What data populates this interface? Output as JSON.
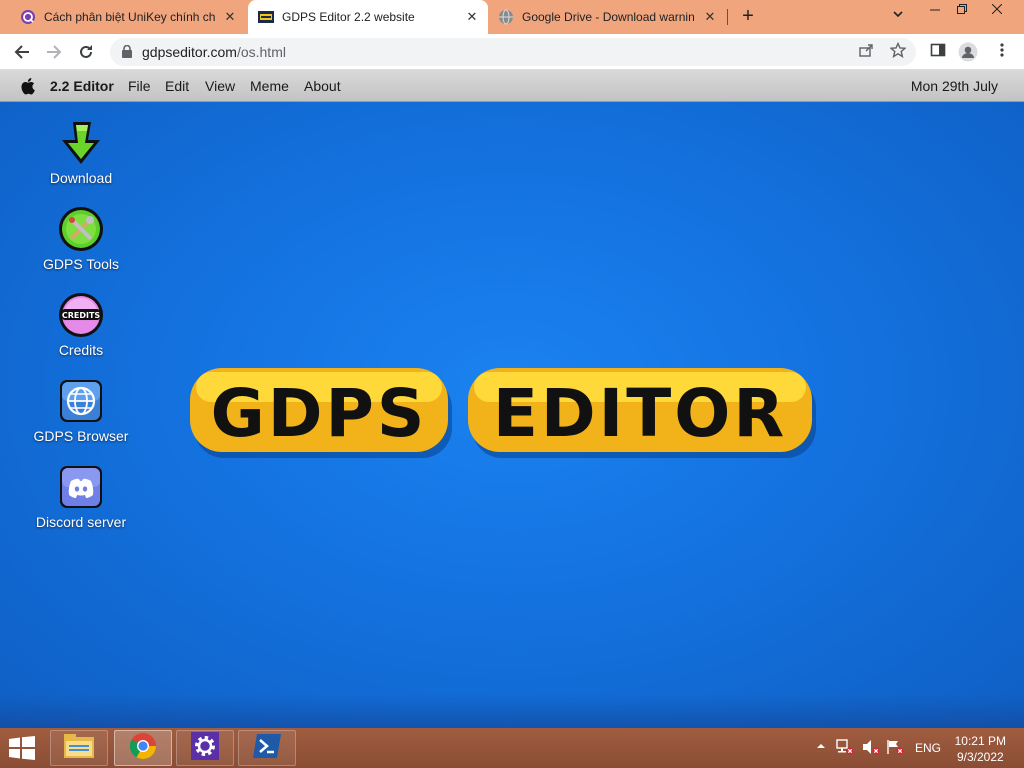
{
  "browser": {
    "tabs": [
      {
        "title": "Cách phân biệt UniKey chính chủ",
        "favicon": "unikey-icon",
        "active": false
      },
      {
        "title": "GDPS Editor 2.2 website",
        "favicon": "gdps-site-icon",
        "active": true
      },
      {
        "title": "Google Drive - Download warning",
        "favicon": "globe-icon",
        "active": false
      }
    ],
    "close_glyph": "✕",
    "new_tab_glyph": "+",
    "url_host": "gdpseditor.com",
    "url_path": "/os.html"
  },
  "menubar": {
    "app_name": "2.2 Editor",
    "items": [
      "File",
      "Edit",
      "View",
      "Meme",
      "About"
    ],
    "date": "Mon 29th July"
  },
  "desktop": {
    "icons": [
      {
        "label": "Download",
        "icon": "download-arrow-icon"
      },
      {
        "label": "GDPS Tools",
        "icon": "tools-icon"
      },
      {
        "label": "Credits",
        "icon": "credits-icon"
      },
      {
        "label": "GDPS Browser",
        "icon": "globe-icon"
      },
      {
        "label": "Discord server",
        "icon": "discord-icon"
      }
    ],
    "logo_text": "GDPS EDITOR",
    "credits_badge": "CREDITS"
  },
  "taskbar": {
    "language": "ENG",
    "time": "10:21 PM",
    "date": "9/3/2022"
  },
  "colors": {
    "tabstrip": "#f0a57d",
    "desktop": "#1472df",
    "taskbar": "#8a4d34",
    "logo_fill": "#111111",
    "logo_outline": "#ffd21a"
  }
}
